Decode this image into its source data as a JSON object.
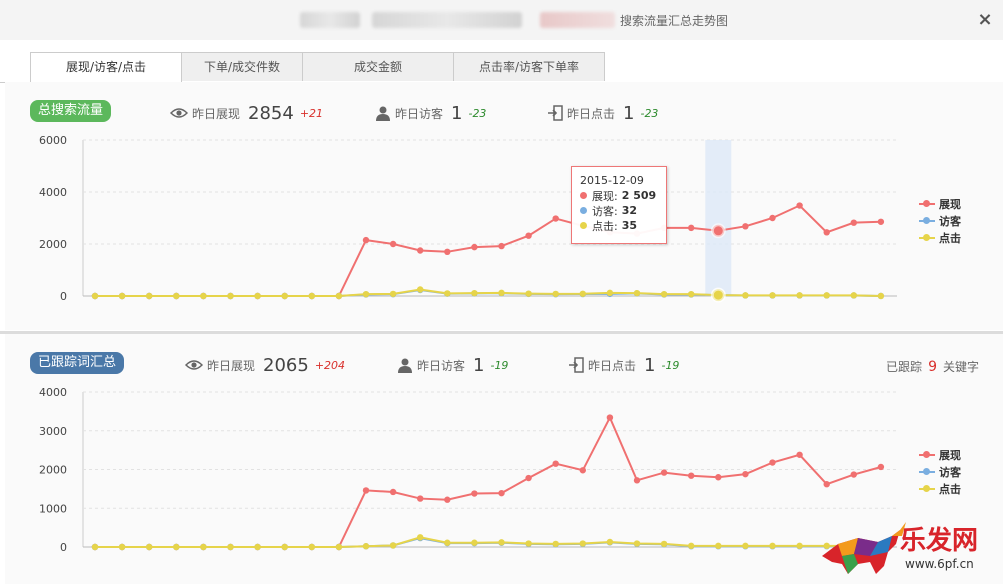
{
  "window": {
    "title": "搜索流量汇总走势图",
    "close_label": "×"
  },
  "tabs": [
    {
      "label": "展现/访客/点击",
      "active": true
    },
    {
      "label": "下单/成交件数",
      "active": false
    },
    {
      "label": "成交金额",
      "active": false
    },
    {
      "label": "点击率/访客下单率",
      "active": false
    }
  ],
  "section1": {
    "badge": "总搜索流量",
    "stats": [
      {
        "label": "昨日展现",
        "value": "2854",
        "delta": "+21",
        "icon": "eye-icon"
      },
      {
        "label": "昨日访客",
        "value": "1",
        "delta": "-23",
        "icon": "user-icon"
      },
      {
        "label": "昨日点击",
        "value": "1",
        "delta": "-23",
        "icon": "click-icon"
      }
    ]
  },
  "section2": {
    "badge": "已跟踪词汇总",
    "stats": [
      {
        "label": "昨日展现",
        "value": "2065",
        "delta": "+204",
        "icon": "eye-icon"
      },
      {
        "label": "昨日访客",
        "value": "1",
        "delta": "-19",
        "icon": "user-icon"
      },
      {
        "label": "昨日点击",
        "value": "1",
        "delta": "-19",
        "icon": "click-icon"
      }
    ],
    "tracked": {
      "prefix": "已跟踪",
      "count": "9",
      "suffix": "关键字"
    }
  },
  "tooltip": {
    "date": "2015-12-09",
    "rows": [
      {
        "label": "展现:",
        "value": "2 509",
        "color": "#f07070"
      },
      {
        "label": "访客:",
        "value": "32",
        "color": "#7aaee0"
      },
      {
        "label": "点击:",
        "value": "35",
        "color": "#e6d44a"
      }
    ]
  },
  "colors": {
    "impressions": "#f07070",
    "visitors": "#7aaee0",
    "clicks": "#e6d44a"
  },
  "watermark": {
    "brand": "乐发网",
    "url": "www.6pf.cn"
  },
  "chart_data": [
    {
      "type": "line",
      "ylim": [
        0,
        6000
      ],
      "yticks": [
        0,
        2000,
        4000,
        6000
      ],
      "grid": true,
      "legend": "right",
      "highlight_index": 23,
      "series": [
        {
          "name": "展现",
          "color": "#f07070",
          "values": [
            0,
            0,
            0,
            0,
            0,
            0,
            0,
            0,
            0,
            0,
            2150,
            2000,
            1750,
            1700,
            1880,
            1920,
            2320,
            2980,
            2700,
            2450,
            2400,
            2620,
            2620,
            2509,
            2680,
            3000,
            3480,
            2450,
            2820,
            2854
          ]
        },
        {
          "name": "访客",
          "color": "#7aaee0",
          "values": [
            0,
            0,
            0,
            0,
            0,
            0,
            0,
            0,
            0,
            0,
            60,
            70,
            230,
            90,
            100,
            110,
            80,
            70,
            75,
            80,
            100,
            60,
            60,
            32,
            20,
            20,
            20,
            20,
            20,
            1
          ]
        },
        {
          "name": "点击",
          "color": "#e6d44a",
          "values": [
            0,
            0,
            0,
            0,
            0,
            0,
            0,
            0,
            0,
            0,
            70,
            80,
            250,
            100,
            110,
            120,
            90,
            80,
            85,
            120,
            110,
            70,
            70,
            35,
            25,
            25,
            25,
            25,
            25,
            1
          ]
        }
      ]
    },
    {
      "type": "line",
      "ylim": [
        0,
        4000
      ],
      "yticks": [
        0,
        1000,
        2000,
        3000,
        4000
      ],
      "grid": true,
      "legend": "right",
      "series": [
        {
          "name": "展现",
          "color": "#f07070",
          "values": [
            0,
            0,
            0,
            0,
            0,
            0,
            0,
            0,
            0,
            0,
            1460,
            1420,
            1250,
            1220,
            1380,
            1390,
            1780,
            2150,
            1980,
            3340,
            1720,
            1920,
            1840,
            1800,
            1880,
            2180,
            2380,
            1620,
            1870,
            2065
          ]
        },
        {
          "name": "访客",
          "color": "#7aaee0",
          "values": [
            0,
            0,
            0,
            0,
            0,
            0,
            0,
            0,
            0,
            0,
            20,
            40,
            230,
            100,
            100,
            110,
            80,
            70,
            80,
            120,
            80,
            70,
            20,
            20,
            20,
            20,
            20,
            20,
            20,
            1
          ]
        },
        {
          "name": "点击",
          "color": "#e6d44a",
          "values": [
            0,
            0,
            0,
            0,
            0,
            0,
            0,
            0,
            0,
            0,
            20,
            40,
            250,
            110,
            110,
            120,
            90,
            80,
            90,
            130,
            90,
            80,
            30,
            30,
            30,
            30,
            30,
            30,
            30,
            1
          ]
        }
      ]
    }
  ]
}
